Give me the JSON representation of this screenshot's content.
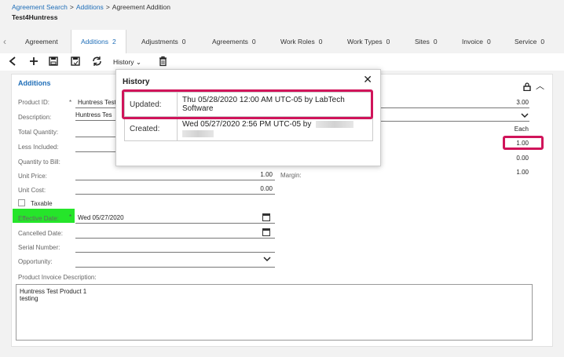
{
  "breadcrumb": {
    "item1": "Agreement Search",
    "item2": "Additions",
    "item3": "Agreement Addition",
    "sep": ">"
  },
  "page_title": "Test4Huntress",
  "tabs": [
    {
      "label": "Agreement",
      "count": ""
    },
    {
      "label": "Additions",
      "count": "2"
    },
    {
      "label": "Adjustments",
      "count": "0"
    },
    {
      "label": "Agreements",
      "count": "0"
    },
    {
      "label": "Work Roles",
      "count": "0"
    },
    {
      "label": "Work Types",
      "count": "0"
    },
    {
      "label": "Sites",
      "count": "0"
    },
    {
      "label": "Invoice",
      "count": "0"
    },
    {
      "label": "Service",
      "count": "0"
    }
  ],
  "toolbar": {
    "history_label": "History"
  },
  "panel": {
    "title": "Additions",
    "fields": {
      "product_id_label": "Product ID:",
      "product_id_value": "Huntress Test",
      "description_label": "Description:",
      "description_value": "Huntress Tes",
      "total_quantity_label": "Total Quantity:",
      "less_included_label": "Less Included:",
      "quantity_to_bill_label": "Quantity to Bill:",
      "unit_price_label": "Unit Price:",
      "unit_price_value": "1.00",
      "unit_cost_label": "Unit Cost:",
      "unit_cost_value": "0.00",
      "taxable_label": "Taxable",
      "effective_date_label": "Effective Date:",
      "effective_date_value": "Wed 05/27/2020",
      "cancelled_date_label": "Cancelled Date:",
      "serial_number_label": "Serial Number:",
      "opportunity_label": "Opportunity:",
      "product_invoice_description_label": "Product Invoice Description:",
      "margin_label": "Margin:",
      "required_mark": "*"
    },
    "right_values": {
      "price": "3.00",
      "uom": "Each",
      "highlighted_value": "1.00",
      "v1": "0.00",
      "v2": "1.00"
    },
    "invoice_description_lines": [
      "Huntress Test Product 1",
      "testing"
    ]
  },
  "history_popup": {
    "title": "History",
    "rows": [
      {
        "label": "Updated:",
        "value": "Thu 05/28/2020 12:00 AM UTC-05 by LabTech Software"
      },
      {
        "label": "Created:",
        "value": "Wed 05/27/2020 2:56 PM UTC-05 by"
      }
    ]
  },
  "colors": {
    "accent": "#1f6eb8",
    "highlight_green": "#25e52a",
    "annotation_red": "#d0145a"
  }
}
